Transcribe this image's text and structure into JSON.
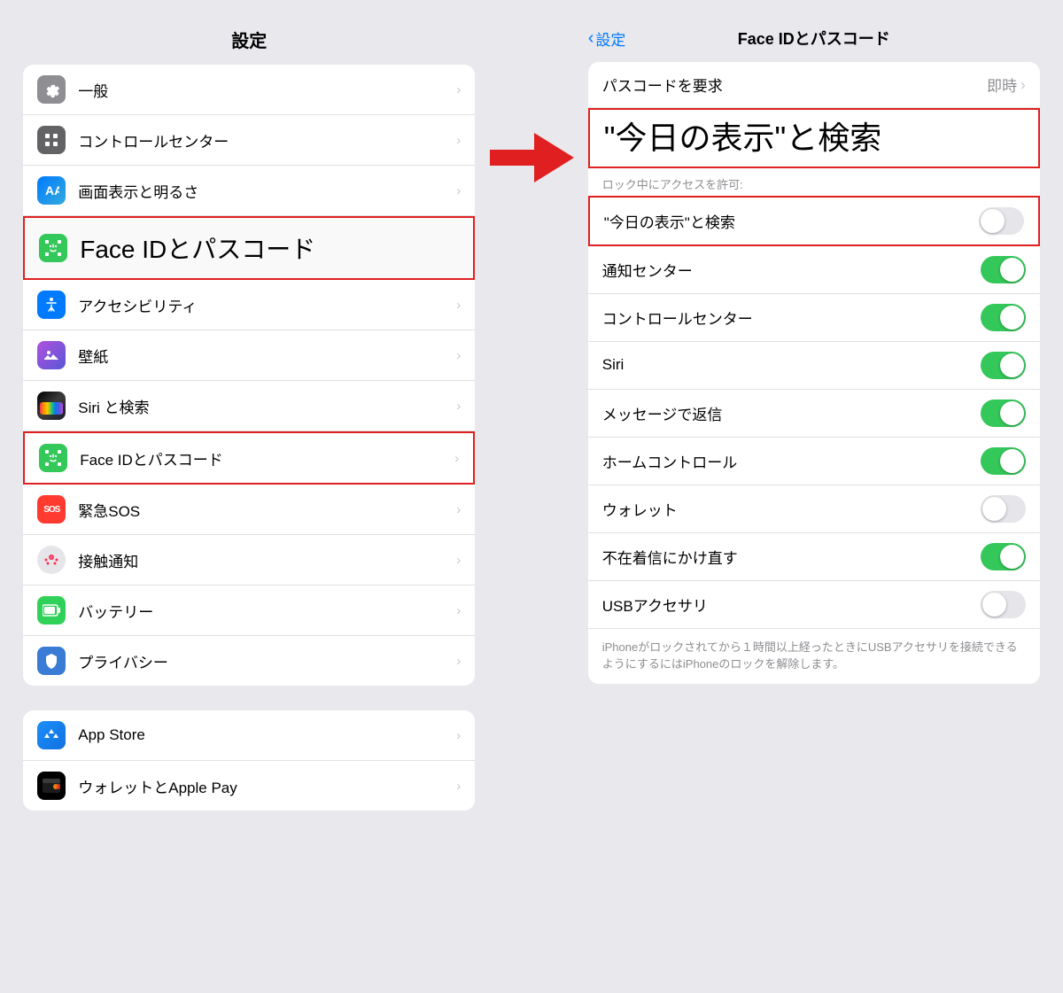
{
  "left_panel": {
    "title": "設定",
    "items_top": [
      {
        "id": "general",
        "label": "一般",
        "icon_type": "gear",
        "icon_bg": "gray",
        "chevron": true
      },
      {
        "id": "control-center",
        "label": "コントロールセンター",
        "icon_type": "control",
        "icon_bg": "gray2",
        "chevron": true
      },
      {
        "id": "display",
        "label": "画面表示と明るさ",
        "icon_type": "display",
        "icon_bg": "blue",
        "chevron": true
      },
      {
        "id": "faceid-large",
        "label": "Face IDとパスコード",
        "icon_type": "faceid",
        "icon_bg": "green",
        "chevron": false,
        "highlight_large": true
      },
      {
        "id": "accessibility",
        "label": "アクセシビリティ",
        "icon_type": "accessibility",
        "icon_bg": "blue",
        "chevron": true
      },
      {
        "id": "wallpaper",
        "label": "壁紙",
        "icon_type": "wallpaper",
        "icon_bg": "purple",
        "chevron": true
      },
      {
        "id": "siri",
        "label": "Siri と検索",
        "icon_type": "siri",
        "icon_bg": "black",
        "chevron": true
      },
      {
        "id": "faceid",
        "label": "Face IDとパスコード",
        "icon_type": "faceid",
        "icon_bg": "green",
        "chevron": true,
        "highlight": true
      },
      {
        "id": "sos",
        "label": "緊急SOS",
        "icon_type": "sos",
        "icon_bg": "red",
        "chevron": true
      },
      {
        "id": "contact",
        "label": "接触通知",
        "icon_type": "contact",
        "icon_bg": "pink2",
        "chevron": true
      },
      {
        "id": "battery",
        "label": "バッテリー",
        "icon_type": "battery",
        "icon_bg": "green2",
        "chevron": true
      },
      {
        "id": "privacy",
        "label": "プライバシー",
        "icon_type": "privacy",
        "icon_bg": "blue2",
        "chevron": true
      }
    ],
    "items_bottom": [
      {
        "id": "appstore",
        "label": "App Store",
        "icon_type": "appstore",
        "icon_bg": "blue",
        "chevron": true
      },
      {
        "id": "wallet",
        "label": "ウォレットとApple Pay",
        "icon_type": "wallet",
        "icon_bg": "black",
        "chevron": true
      }
    ]
  },
  "right_panel": {
    "back_label": "設定",
    "title": "Face IDとパスコード",
    "passcode_row": {
      "label": "パスコードを要求",
      "value": "即時"
    },
    "big_heading": "\"今日の表示\"と検索",
    "section_label": "ロック中にアクセスを許可:",
    "toggle_rows": [
      {
        "id": "today-view",
        "label": "\"今日の表示\"と検索",
        "state": "off",
        "highlight": true
      },
      {
        "id": "notification-center",
        "label": "通知センター",
        "state": "on"
      },
      {
        "id": "control-center",
        "label": "コントロールセンター",
        "state": "on"
      },
      {
        "id": "siri",
        "label": "Siri",
        "state": "on"
      },
      {
        "id": "message-reply",
        "label": "メッセージで返信",
        "state": "on"
      },
      {
        "id": "home-control",
        "label": "ホームコントロール",
        "state": "on"
      },
      {
        "id": "wallet",
        "label": "ウォレット",
        "state": "off"
      },
      {
        "id": "missed-call",
        "label": "不在着信にかけ直す",
        "state": "on"
      },
      {
        "id": "usb",
        "label": "USBアクセサリ",
        "state": "off"
      }
    ],
    "footer_note": "iPhoneがロックされてから１時間以上経ったときにUSBアクセサリを接続できるようにするにはiPhoneのロックを解除します。"
  }
}
